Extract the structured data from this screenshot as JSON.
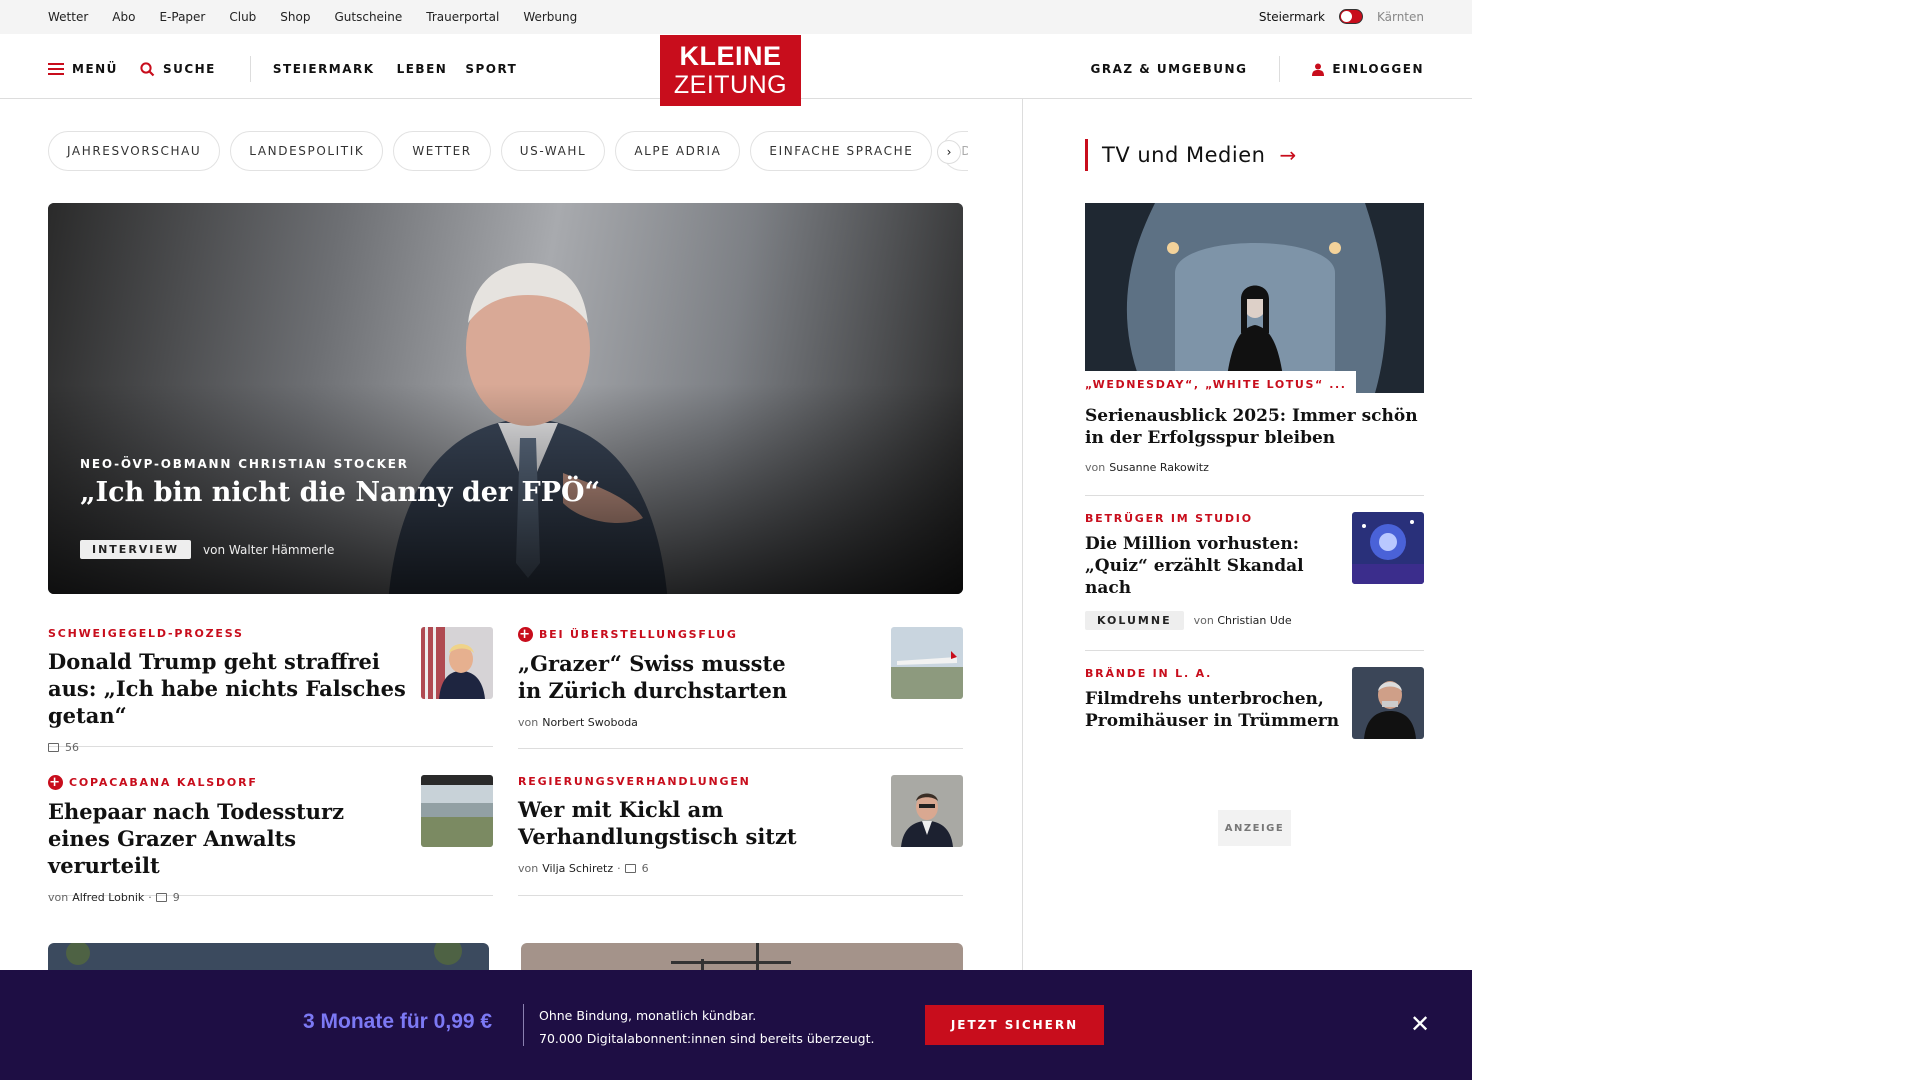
{
  "utility": {
    "links": [
      "Wetter",
      "Abo",
      "E-Paper",
      "Club",
      "Shop",
      "Gutscheine",
      "Trauerportal",
      "Werbung"
    ],
    "region_active": "Steiermark",
    "region_inactive": "Kärnten"
  },
  "header": {
    "menu": "MENÜ",
    "search": "SUCHE",
    "nav": [
      "STEIERMARK",
      "LEBEN",
      "SPORT"
    ],
    "logo_line1": "KLEINE",
    "logo_line2": "ZEITUNG",
    "region_link": "GRAZ & UMGEBUNG",
    "login": "EINLOGGEN"
  },
  "topics": [
    "JAHRESVORSCHAU",
    "LANDESPOLITIK",
    "WETTER",
    "US-WAHL",
    "ALPE ADRIA",
    "EINFACHE SPRACHE",
    "DOS"
  ],
  "hero": {
    "kicker": "NEO-ÖVP-OBMANN CHRISTIAN STOCKER",
    "title": "„Ich bin nicht die Nanny der FPÖ“",
    "tag": "INTERVIEW",
    "byline": "von Walter Hämmerle"
  },
  "teasers": [
    {
      "kicker": "SCHWEIGEGELD-PROZESS",
      "plus": false,
      "title": "Donald Trump geht straffrei aus: „Ich habe nichts Falsches getan“",
      "by_prefix": "",
      "author": "",
      "comments": "56"
    },
    {
      "kicker": "BEI ÜBERSTELLUNGSFLUG",
      "plus": true,
      "title": "„Grazer“ Swiss musste in Zürich durchstarten",
      "by_prefix": "von",
      "author": "Norbert Swoboda",
      "comments": ""
    },
    {
      "kicker": "COPACABANA KALSDORF",
      "plus": true,
      "title": "Ehepaar nach Todessturz eines Grazer Anwalts verurteilt",
      "by_prefix": "von",
      "author": "Alfred Lobnik",
      "comments": "9"
    },
    {
      "kicker": "REGIERUNGSVERHANDLUNGEN",
      "plus": false,
      "title": "Wer mit Kickl am Verhandlungstisch sitzt",
      "by_prefix": "von",
      "author": "Vilja Schiretz",
      "comments": "6"
    }
  ],
  "sidebar": {
    "section": "TV und Medien",
    "lead": {
      "kicker": "„WEDNESDAY“, „WHITE LOTUS“ ...",
      "title": "Serienausblick 2025: Immer schön in der Erfolgsspur bleiben",
      "by_prefix": "von",
      "author": "Susanne Rakowitz"
    },
    "items": [
      {
        "kicker": "BETRÜGER IM STUDIO",
        "title": "Die Million vorhusten: „Quiz“ erzählt Skandal nach",
        "tag": "KOLUMNE",
        "by_prefix": "von",
        "author": "Christian Ude"
      },
      {
        "kicker": "BRÄNDE IN L. A.",
        "title": "Filmdrehs unterbrochen, Promihäuser in Trümmern"
      }
    ],
    "ad_label": "ANZEIGE"
  },
  "promo": {
    "price": "3 Monate für 0,99 €",
    "line1": "Ohne Bindung, monatlich kündbar.",
    "line2": "70.000 Digitalabonnent:innen sind bereits überzeugt.",
    "cta": "JETZT SICHERN",
    "close": "✕"
  },
  "colors": {
    "brand_red": "#c80d1c",
    "promo_bg": "#1e0e44",
    "promo_price": "#7c79f4"
  }
}
